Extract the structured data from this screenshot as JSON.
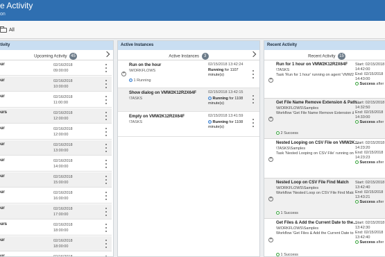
{
  "header": {
    "title": "e Activity",
    "subtitle": "on"
  },
  "toolbar": {
    "filter_label": "All"
  },
  "upcoming": {
    "head": "ctivity",
    "sub_label": "Upcoming Activity",
    "count": "45",
    "rows": [
      {
        "name": "our",
        "date": "02/16/2018",
        "time": "09:00:00"
      },
      {
        "name": "our",
        "date": "02/16/2018",
        "time": "10:00:00"
      },
      {
        "name": "our",
        "date": "02/16/2018",
        "time": "11:00:00"
      },
      {
        "name": "ours",
        "date": "02/16/2018",
        "time": "12:00:00"
      },
      {
        "name": "our",
        "date": "02/16/2018",
        "time": "12:00:00"
      },
      {
        "name": "our",
        "date": "02/16/2018",
        "time": "13:00:00"
      },
      {
        "name": "our",
        "date": "02/16/2018",
        "time": "14:00:00"
      },
      {
        "name": "our",
        "date": "02/16/2018",
        "time": "15:00:00"
      },
      {
        "name": "our",
        "date": "02/16/2018",
        "time": "16:00:00"
      },
      {
        "name": "our",
        "date": "02/16/2018",
        "time": "17:00:00"
      },
      {
        "name": "ours",
        "date": "02/16/2018",
        "time": "18:00:00"
      },
      {
        "name": "our",
        "date": "02/16/2018",
        "time": "18:00:00"
      },
      {
        "name": "our",
        "date": "02/16/2018",
        "time": ""
      }
    ]
  },
  "active": {
    "head": "Active Instances",
    "sub_label": "Active Instances",
    "count": "3",
    "items": [
      {
        "name": "Run on the hour",
        "path": "\\WORKFLOWS",
        "sub": "1 Running",
        "when": "02/15/2018 13:42:24",
        "status": "Running",
        "status_rest": "for 1107 minute(s)"
      },
      {
        "name": "Show dialog on VMW2K12R2X64F",
        "path": "\\TASKS",
        "sub": "",
        "when": "02/15/2018 13:42:15",
        "status": "Running",
        "status_rest": "for 1108 minute(s)"
      },
      {
        "name": "Empty on VMW2K12R2X64F",
        "path": "\\TASKS",
        "sub": "",
        "when": "02/15/2018 13:41:59",
        "status": "Running",
        "status_rest": "for 1108 minute(s)"
      }
    ]
  },
  "recent": {
    "head": "Recent Activity",
    "sub_label": "Recent Activity",
    "count": "15",
    "items": [
      {
        "name": "Run for 1 hour on VMW2K12R2X64F",
        "path": "\\TASKS",
        "desc": "Task 'Run for 1 hour' running on agent 'VMW2K1...",
        "start": "Start: 02/15/2018",
        "start_time": "14:42:00",
        "end": "End: 02/15/2018",
        "end_time": "14:43:00",
        "result": "Success",
        "result_rest": "after 1 minute(s)",
        "count": ""
      },
      {
        "name": "Get File Name Remove Extension & Path...",
        "path": "\\WORKFLOWS\\Samples",
        "desc": "Workflow 'Get File Name Remove Extension & P...",
        "start": "Start: 02/15/2018",
        "start_time": "14:32:50",
        "end": "End: 02/15/2018",
        "end_time": "14:33:00",
        "result": "Success",
        "result_rest": "after 1 minute(s)",
        "count": "2 Success"
      },
      {
        "name": "Nested Looping on CSV File on VMW2K...",
        "path": "\\TASKS\\Samples",
        "desc": "Task 'Nested Looping on CSV File' running on ag...",
        "start": "Start: 02/15/2018",
        "start_time": "14:23:20",
        "end": "End: 02/15/2018",
        "end_time": "14:23:23",
        "result": "Success",
        "result_rest": "after 1 minute(s)",
        "count": ""
      },
      {
        "name": "Nested Loop on CSV File Find Match",
        "path": "\\WORKFLOWS\\Samples",
        "desc": "Workflow 'Nested Loop on CSV File Find Match'...",
        "start": "Start: 02/15/2018",
        "start_time": "13:42:40",
        "end": "End: 02/15/2018",
        "end_time": "13:43:21",
        "result": "Success",
        "result_rest": "after 1 minute(s)",
        "count": "1 Success"
      },
      {
        "name": "Get Files & Add the Current Date to the...",
        "path": "\\WORKFLOWS\\Samples",
        "desc": "Workflow 'Get Files & Add the Current Date to the...",
        "start": "Start: 02/15/2018",
        "start_time": "13:42:30",
        "end": "End: 02/15/2018",
        "end_time": "13:42:40",
        "result": "Success",
        "result_rest": "after 1 minute(s)",
        "count": "1 Success"
      }
    ]
  }
}
